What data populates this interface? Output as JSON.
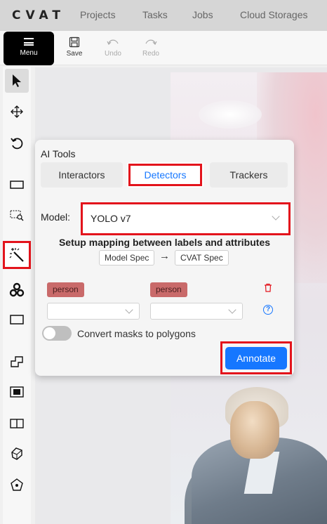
{
  "app": {
    "logo": "CVAT"
  },
  "nav": [
    {
      "label": "Projects"
    },
    {
      "label": "Tasks"
    },
    {
      "label": "Jobs"
    },
    {
      "label": "Cloud Storages"
    }
  ],
  "toolbar": {
    "menu_label": "Menu",
    "save_label": "Save",
    "undo_label": "Undo",
    "redo_label": "Redo"
  },
  "tools": [
    {
      "icon": "cursor-icon"
    },
    {
      "icon": "move-icon"
    },
    {
      "icon": "rotate-icon"
    },
    {
      "icon": "fit-image-icon"
    },
    {
      "icon": "zoom-region-icon"
    },
    {
      "icon": "ai-tools-magic-wand-icon",
      "selected": true
    },
    {
      "icon": "opencv-icon"
    },
    {
      "icon": "rectangle-icon"
    },
    {
      "icon": "polygon-icon"
    },
    {
      "icon": "polyline-icon"
    },
    {
      "icon": "points-icon"
    },
    {
      "icon": "ellipse-icon"
    },
    {
      "icon": "cuboid-icon"
    },
    {
      "icon": "mask-icon"
    }
  ],
  "ai_tools": {
    "title": "AI Tools",
    "tabs": [
      {
        "label": "Interactors",
        "active": false
      },
      {
        "label": "Detectors",
        "active": true
      },
      {
        "label": "Trackers",
        "active": false
      }
    ],
    "model_label": "Model:",
    "model_value": "YOLO v7",
    "mapping_title": "Setup mapping between labels and attributes",
    "model_spec": "Model Spec",
    "cvat_spec": "CVAT Spec",
    "model_label_tag": "person",
    "cvat_label_tag": "person",
    "convert_label": "Convert masks to polygons",
    "convert_enabled": false,
    "annotate_label": "Annotate"
  },
  "colors": {
    "highlight": "#e3141c",
    "primary": "#1677ff",
    "label_tag": "#c96a6a"
  }
}
